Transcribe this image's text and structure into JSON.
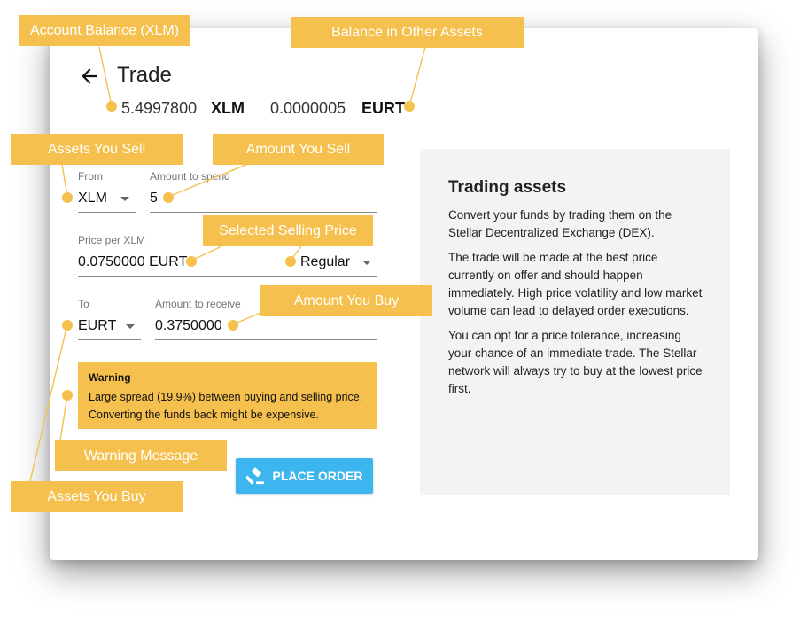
{
  "header": {
    "title": "Trade"
  },
  "balances": {
    "xlm_amount": "5.4997800",
    "xlm_code": "XLM",
    "other_amount": "0.0000005",
    "other_code": "EURT"
  },
  "form": {
    "from_label": "From",
    "from_value": "XLM",
    "spend_label": "Amount to spend",
    "spend_value": "5",
    "price_label": "Price per XLM",
    "price_value": "0.0750000 EURT",
    "price_mode": "Regular",
    "to_label": "To",
    "to_value": "EURT",
    "receive_label": "Amount to receive",
    "receive_value": "0.3750000"
  },
  "warning": {
    "title": "Warning",
    "message": "Large spread (19.9%) between buying and selling price. Converting the funds back might be expensive."
  },
  "button": {
    "label": "PLACE ORDER",
    "icon": "gavel-icon"
  },
  "info": {
    "title": "Trading assets",
    "p1": "Convert your funds by trading them on the Stellar Decentralized Exchange (DEX).",
    "p2": "The trade will be made at the best price currently on offer and should happen immediately. High price volatility and low market volume can lead to delayed order executions.",
    "p3": "You can opt for a price tolerance, increasing your chance of an immediate trade. The Stellar network will always try to buy at the lowest price first."
  },
  "callouts": {
    "account_balance": "Account Balance (XLM)",
    "other_assets": "Balance in Other Assets",
    "assets_sell": "Assets You Sell",
    "amount_sell": "Amount You Sell",
    "selling_price": "Selected Selling Price",
    "amount_buy": "Amount You Buy",
    "warning_message": "Warning Message",
    "assets_buy": "Assets You Buy"
  },
  "colors": {
    "callout": "#f5c04e",
    "button": "#3db5ee",
    "panel": "#f3f3f3"
  }
}
